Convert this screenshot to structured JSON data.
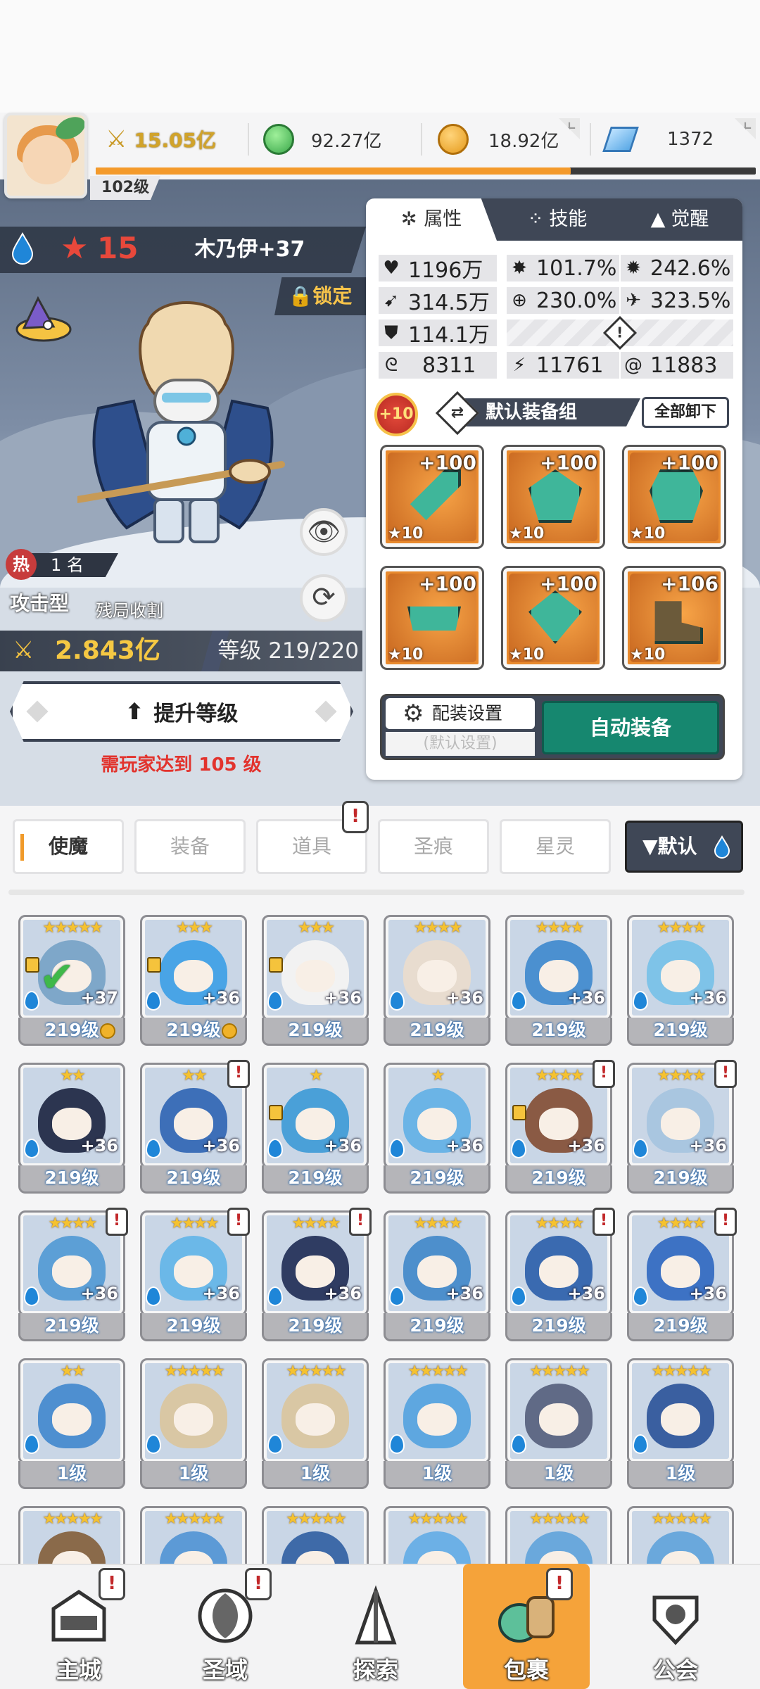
{
  "player": {
    "level": "102级"
  },
  "resources": {
    "power": "15.05亿",
    "green_gem": "92.27亿",
    "gold": "18.92亿",
    "diamond": "1372",
    "exp_progress": 0.72
  },
  "hero": {
    "stars": "15",
    "name": "木乃伊+37",
    "lock_label": "锁定",
    "rank_hot": "热",
    "rank_label": "1 名",
    "type": "攻击型",
    "type_desc": "残局收割",
    "power": "2.843亿",
    "level": "等级 219/220",
    "upgrade_label": "提升等级",
    "requirement": "需玩家达到 105 级"
  },
  "panel": {
    "tabs": [
      {
        "label": "属性",
        "icon": "attribute-icon"
      },
      {
        "label": "技能",
        "icon": "skill-icon"
      },
      {
        "label": "觉醒",
        "icon": "awaken-icon"
      }
    ],
    "stats": {
      "hp": "1196万",
      "crit": "101.7%",
      "crit_dmg": "242.6%",
      "atk": "314.5万",
      "accuracy": "230.0%",
      "speed": "323.5%",
      "def": "114.1万",
      "s1": "8311",
      "s2": "11761",
      "s3": "11883"
    },
    "badge": "+10",
    "equip_set": "默认装备组",
    "unequip_all": "全部卸下",
    "config_label": "配装设置",
    "config_sub": "(默认设置)",
    "auto_equip": "自动装备",
    "equipment": [
      {
        "level": "+100",
        "stars": "★10",
        "icon": "sword-icon"
      },
      {
        "level": "+100",
        "stars": "★10",
        "icon": "armor-icon"
      },
      {
        "level": "+100",
        "stars": "★10",
        "icon": "chestplate-icon"
      },
      {
        "level": "+100",
        "stars": "★10",
        "icon": "belt-icon"
      },
      {
        "level": "+100",
        "stars": "★10",
        "icon": "necklace-icon"
      },
      {
        "level": "+106",
        "stars": "★10",
        "icon": "boots-icon"
      }
    ]
  },
  "inventory": {
    "tabs": [
      "使魔",
      "装备",
      "道具",
      "圣痕",
      "星灵"
    ],
    "sort_label": "▼默认",
    "alert": "!"
  },
  "heroes": [
    {
      "stars": "★★★★★",
      "plus": "+37",
      "level": "219级",
      "lock": true,
      "check": true,
      "gold": true,
      "ex": false,
      "color": "#7ea7c9"
    },
    {
      "stars": "★★★",
      "plus": "+36",
      "level": "219级",
      "lock": true,
      "check": false,
      "gold": true,
      "ex": false,
      "color": "#49a4e6"
    },
    {
      "stars": "★★★",
      "plus": "+36",
      "level": "219级",
      "lock": true,
      "check": false,
      "gold": false,
      "ex": false,
      "color": "#f2f2f2"
    },
    {
      "stars": "★★★★",
      "plus": "+36",
      "level": "219级",
      "lock": false,
      "check": false,
      "gold": false,
      "ex": false,
      "color": "#e8dccf"
    },
    {
      "stars": "★★★★",
      "plus": "+36",
      "level": "219级",
      "lock": false,
      "check": false,
      "gold": false,
      "ex": false,
      "color": "#4b90d0"
    },
    {
      "stars": "★★★★",
      "plus": "+36",
      "level": "219级",
      "lock": false,
      "check": false,
      "gold": false,
      "ex": false,
      "color": "#7ec3e8"
    },
    {
      "stars": "★★",
      "plus": "+36",
      "level": "219级",
      "lock": false,
      "check": false,
      "gold": false,
      "ex": false,
      "color": "#2c3550"
    },
    {
      "stars": "★★",
      "plus": "+36",
      "level": "219级",
      "lock": false,
      "check": false,
      "gold": false,
      "ex": true,
      "color": "#3d6fb8"
    },
    {
      "stars": "★",
      "plus": "+36",
      "level": "219级",
      "lock": true,
      "check": false,
      "gold": false,
      "ex": false,
      "color": "#4aa0d8"
    },
    {
      "stars": "★",
      "plus": "+36",
      "level": "219级",
      "lock": false,
      "check": false,
      "gold": false,
      "ex": false,
      "color": "#6bb4e6"
    },
    {
      "stars": "★★★★",
      "plus": "+36",
      "level": "219级",
      "lock": true,
      "check": false,
      "gold": false,
      "ex": true,
      "color": "#8a5a44"
    },
    {
      "stars": "★★★★",
      "plus": "+36",
      "level": "219级",
      "lock": false,
      "check": false,
      "gold": false,
      "ex": true,
      "color": "#a9c6e0"
    },
    {
      "stars": "★★★★",
      "plus": "+36",
      "level": "219级",
      "lock": false,
      "check": false,
      "gold": false,
      "ex": true,
      "color": "#5c9fd6"
    },
    {
      "stars": "★★★★",
      "plus": "+36",
      "level": "219级",
      "lock": false,
      "check": false,
      "gold": false,
      "ex": true,
      "color": "#6bb8e8"
    },
    {
      "stars": "★★★★",
      "plus": "+36",
      "level": "219级",
      "lock": false,
      "check": false,
      "gold": false,
      "ex": true,
      "color": "#2f3c62"
    },
    {
      "stars": "★★★★",
      "plus": "+36",
      "level": "219级",
      "lock": false,
      "check": false,
      "gold": false,
      "ex": false,
      "color": "#4d8fcc"
    },
    {
      "stars": "★★★★",
      "plus": "+36",
      "level": "219级",
      "lock": false,
      "check": false,
      "gold": false,
      "ex": true,
      "color": "#3a6ab0"
    },
    {
      "stars": "★★★★",
      "plus": "+36",
      "level": "219级",
      "lock": false,
      "check": false,
      "gold": false,
      "ex": true,
      "color": "#3d72c4"
    },
    {
      "stars": "★★",
      "plus": "",
      "level": "1级",
      "lock": false,
      "check": false,
      "gold": false,
      "ex": false,
      "color": "#4e8fd0"
    },
    {
      "stars": "★★★★★",
      "plus": "",
      "level": "1级",
      "lock": false,
      "check": false,
      "gold": false,
      "ex": false,
      "color": "#d9c7a4"
    },
    {
      "stars": "★★★★★",
      "plus": "",
      "level": "1级",
      "lock": false,
      "check": false,
      "gold": false,
      "ex": false,
      "color": "#d9c7a4"
    },
    {
      "stars": "★★★★★",
      "plus": "",
      "level": "1级",
      "lock": false,
      "check": false,
      "gold": false,
      "ex": false,
      "color": "#5ea7e0"
    },
    {
      "stars": "★★★★★",
      "plus": "",
      "level": "1级",
      "lock": false,
      "check": false,
      "gold": false,
      "ex": false,
      "color": "#606a86"
    },
    {
      "stars": "★★★★★",
      "plus": "",
      "level": "1级",
      "lock": false,
      "check": false,
      "gold": false,
      "ex": false,
      "color": "#3a5fa0"
    },
    {
      "stars": "★★★★★",
      "plus": "",
      "level": "",
      "lock": false,
      "check": false,
      "gold": false,
      "ex": false,
      "color": "#8a6a4a"
    },
    {
      "stars": "★★★★★",
      "plus": "",
      "level": "",
      "lock": false,
      "check": false,
      "gold": false,
      "ex": false,
      "color": "#5c9ad6"
    },
    {
      "stars": "★★★★★",
      "plus": "",
      "level": "",
      "lock": false,
      "check": false,
      "gold": false,
      "ex": false,
      "color": "#3e6aa8"
    },
    {
      "stars": "★★★★★",
      "plus": "",
      "level": "",
      "lock": false,
      "check": false,
      "gold": false,
      "ex": false,
      "color": "#6cb0e6"
    },
    {
      "stars": "★★★★★",
      "plus": "",
      "level": "",
      "lock": false,
      "check": false,
      "gold": false,
      "ex": false,
      "color": "#6aa8dc"
    },
    {
      "stars": "★★★★★",
      "plus": "",
      "level": "",
      "lock": false,
      "check": false,
      "gold": false,
      "ex": false,
      "color": "#6aa8dc"
    }
  ],
  "nav": [
    {
      "label": "主城",
      "icon": "city-icon",
      "alert": true
    },
    {
      "label": "圣域",
      "icon": "sanctuary-icon",
      "alert": true
    },
    {
      "label": "探索",
      "icon": "explore-icon",
      "alert": false
    },
    {
      "label": "包裹",
      "icon": "bag-icon",
      "alert": true
    },
    {
      "label": "公会",
      "icon": "guild-icon",
      "alert": false
    }
  ],
  "colors": {
    "accent_orange": "#f49a2b",
    "teal": "#16876f",
    "panel_dark": "#3f4756",
    "red": "#e2332d"
  }
}
